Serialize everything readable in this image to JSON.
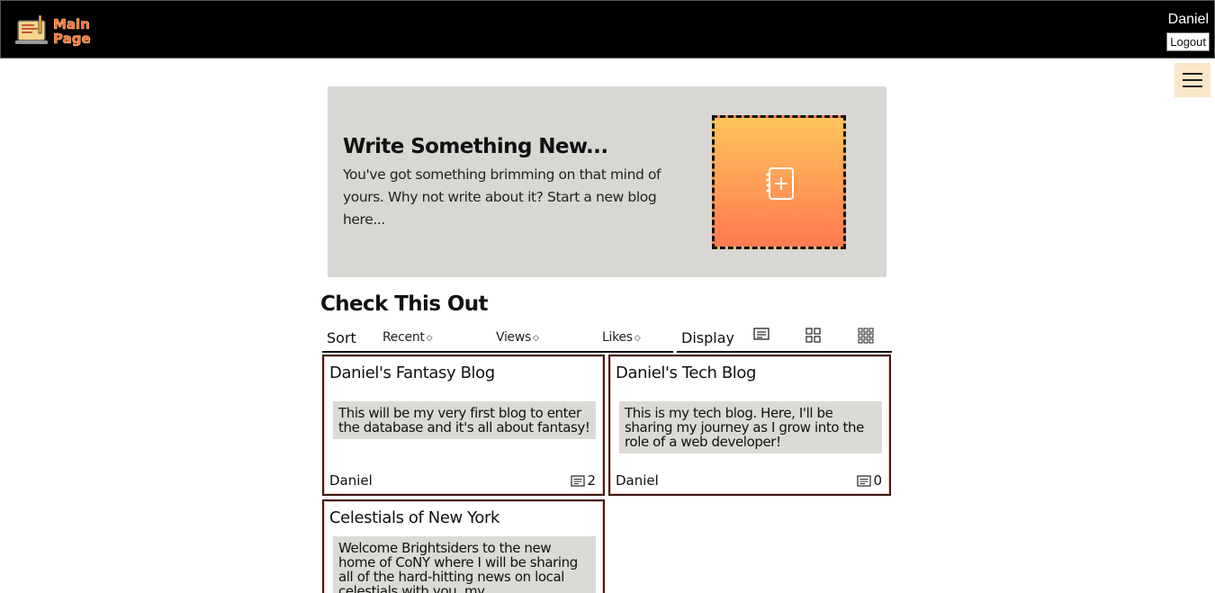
{
  "header": {
    "logo_text": "Main Page",
    "user_name": "Daniel",
    "logout_label": "Logout"
  },
  "banner": {
    "title": "Write Something New...",
    "text": "You've got something brimming on that mind of yours. Why not write about it? Start a new blog here..."
  },
  "section": {
    "title": "Check This Out"
  },
  "sort": {
    "label": "Sort",
    "options": [
      "Recent",
      "Views",
      "Likes"
    ]
  },
  "display": {
    "label": "Display",
    "icons": [
      "list-view-icon",
      "grid-view-icon",
      "compact-grid-view-icon"
    ]
  },
  "blogs": [
    {
      "title": "Daniel's Fantasy Blog",
      "description": "This will be my very first blog to enter the database and it's all about fantasy!",
      "author": "Daniel",
      "count": "2"
    },
    {
      "title": "Daniel's Tech Blog",
      "description": "This is my tech blog. Here, I'll be sharing my journey as I grow into the role of a web developer!",
      "author": "Daniel",
      "count": "0"
    },
    {
      "title": "Celestials of New York",
      "description": "Welcome Brightsiders to the new home of CoNY where I will be sharing all of the hard-hitting news on local celestials with you, my",
      "author": "",
      "count": ""
    }
  ],
  "colors": {
    "header_bg": "#000000",
    "banner_bg": "#d9d7d3",
    "tile_gradient_top": "#ffc35c",
    "tile_gradient_bottom": "#ff7a50",
    "menu_button_bg": "#fbe7c8"
  }
}
